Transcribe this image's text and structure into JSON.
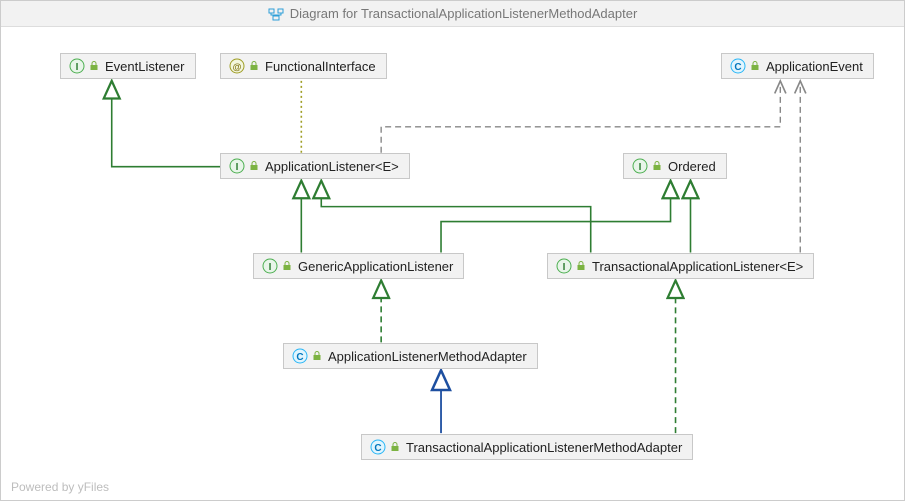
{
  "title": "Diagram for TransactionalApplicationListenerMethodAdapter",
  "footer": "Powered by yFiles",
  "nodes": {
    "eventListener": {
      "label": "EventListener",
      "kind": "interface"
    },
    "functionalInterface": {
      "label": "FunctionalInterface",
      "kind": "annotation"
    },
    "applicationEvent": {
      "label": "ApplicationEvent",
      "kind": "class"
    },
    "applicationListener": {
      "label": "ApplicationListener<E>",
      "kind": "interface"
    },
    "ordered": {
      "label": "Ordered",
      "kind": "interface"
    },
    "genericApplicationListener": {
      "label": "GenericApplicationListener",
      "kind": "interface"
    },
    "transactionalApplicationListener": {
      "label": "TransactionalApplicationListener<E>",
      "kind": "interface"
    },
    "applicationListenerMethodAdapter": {
      "label": "ApplicationListenerMethodAdapter",
      "kind": "class"
    },
    "transactionalApplicationListenerMethodAdapter": {
      "label": "TransactionalApplicationListenerMethodAdapter",
      "kind": "class"
    }
  },
  "edges": [
    {
      "from": "applicationListener",
      "to": "eventListener",
      "type": "extends-interface"
    },
    {
      "from": "applicationListener",
      "to": "functionalInterface",
      "type": "annotation"
    },
    {
      "from": "applicationListener",
      "to": "applicationEvent",
      "type": "dependency"
    },
    {
      "from": "genericApplicationListener",
      "to": "applicationListener",
      "type": "extends-interface"
    },
    {
      "from": "genericApplicationListener",
      "to": "ordered",
      "type": "extends-interface"
    },
    {
      "from": "transactionalApplicationListener",
      "to": "applicationListener",
      "type": "extends-interface"
    },
    {
      "from": "transactionalApplicationListener",
      "to": "ordered",
      "type": "extends-interface"
    },
    {
      "from": "applicationListenerMethodAdapter",
      "to": "genericApplicationListener",
      "type": "implements"
    },
    {
      "from": "transactionalApplicationListenerMethodAdapter",
      "to": "applicationListenerMethodAdapter",
      "type": "extends-class"
    },
    {
      "from": "transactionalApplicationListenerMethodAdapter",
      "to": "transactionalApplicationListener",
      "type": "implements"
    },
    {
      "from": "transactionalApplicationListener",
      "to": "applicationEvent",
      "type": "dependency"
    }
  ],
  "colors": {
    "interface": "#4caf50",
    "annotation": "#9e9d24",
    "class": "#29b6f6",
    "extendsClass": "#1d4fa0",
    "extendsInterface": "#2e7d32",
    "implements": "#2e7d32",
    "dependency": "#888888"
  }
}
